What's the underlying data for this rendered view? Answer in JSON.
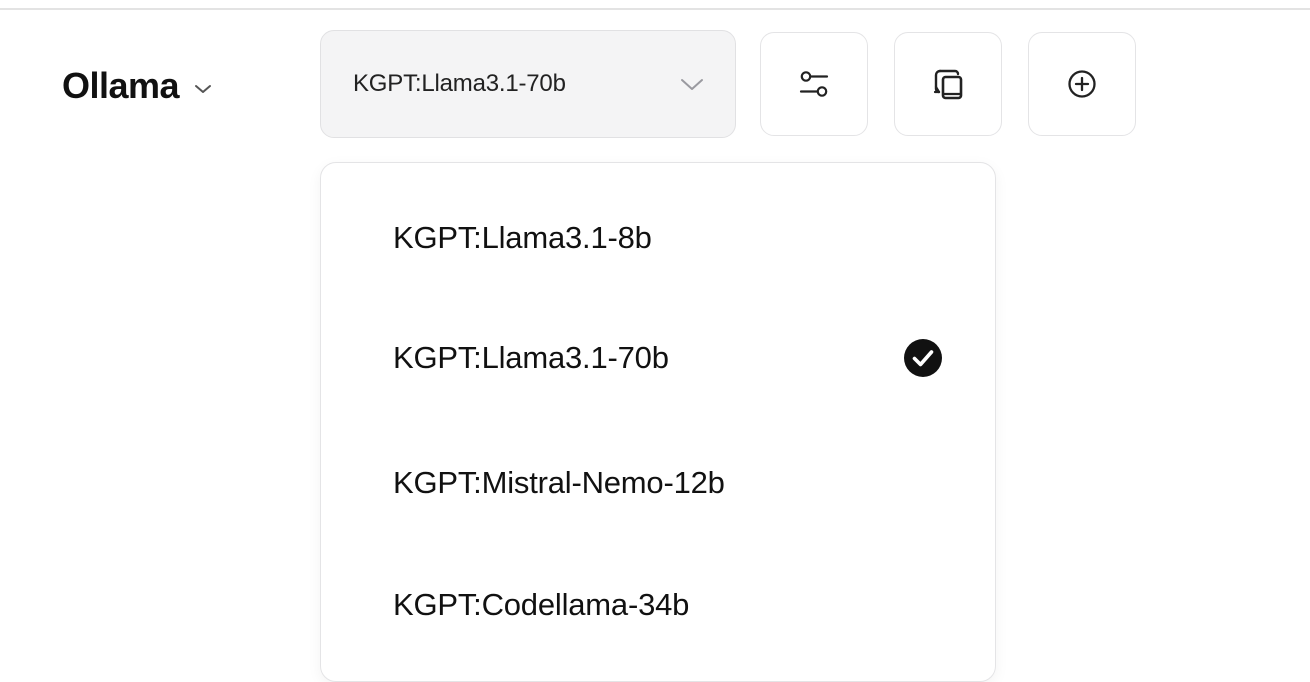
{
  "provider": {
    "label": "Ollama",
    "chevron_icon": "chevron-down-icon"
  },
  "model_select": {
    "value": "KGPT:Llama3.1-70b",
    "chevron_icon": "chevron-down-icon"
  },
  "toolbar": {
    "buttons": [
      {
        "icon": "sliders-icon"
      },
      {
        "icon": "copy-icon"
      },
      {
        "icon": "plus-circle-icon"
      }
    ]
  },
  "dropdown": {
    "options": [
      {
        "label": "KGPT:Llama3.1-8b",
        "selected": false
      },
      {
        "label": "KGPT:Llama3.1-70b",
        "selected": true
      },
      {
        "label": "KGPT:Mistral-Nemo-12b",
        "selected": false
      },
      {
        "label": "KGPT:Codellama-34b",
        "selected": false
      }
    ],
    "selected_icon": "check-circle-icon"
  },
  "colors": {
    "select_background": "#f4f4f5",
    "border": "#e4e4e6",
    "text": "#111111"
  }
}
